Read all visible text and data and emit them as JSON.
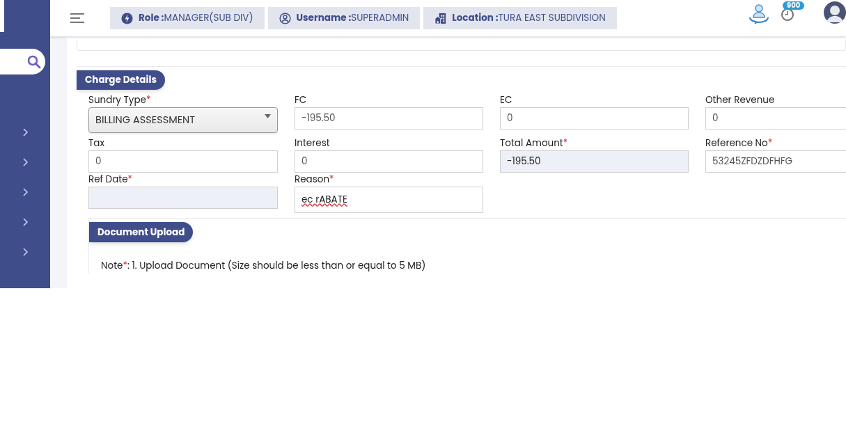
{
  "header": {
    "chips": [
      {
        "kind": "role",
        "label": "Role :",
        "value": "MANAGER(SUB DIV)"
      },
      {
        "kind": "user",
        "label": "Username :",
        "value": "SUPERADMIN"
      },
      {
        "kind": "location",
        "label": "Location :",
        "value": "TURA EAST SUBDIVISION"
      }
    ],
    "notification_count": "900"
  },
  "sidebar": {
    "items": [
      {
        "expanded": false
      },
      {
        "expanded": false
      },
      {
        "expanded": false
      },
      {
        "expanded": false
      },
      {
        "expanded": false
      }
    ]
  },
  "charge_details": {
    "title": "Charge Details",
    "fields": [
      {
        "label": "Sundry Type",
        "required_mark": "*",
        "kind": "select",
        "value": "BILLING ASSESSMENT"
      },
      {
        "label": "FC",
        "kind": "input",
        "value": "-195.50"
      },
      {
        "label": "EC",
        "kind": "input",
        "value": "0"
      },
      {
        "label": "Other Revenue",
        "kind": "input",
        "value": "0"
      },
      {
        "label": "Tax",
        "kind": "input",
        "value": "0"
      },
      {
        "label": "Interest",
        "kind": "input",
        "value": "0"
      },
      {
        "label": "Total Amount",
        "required_mark": "*",
        "kind": "readonly",
        "value": "-195.50"
      },
      {
        "label": "Reference No",
        "required_mark": "*",
        "kind": "input",
        "value": "53245ZFDZDFHFG"
      },
      {
        "label": "Ref Date",
        "required_mark": "*",
        "kind": "readonly"
      },
      {
        "label": "Reason",
        "required_mark": "*",
        "kind": "text",
        "value": "ec rABATE",
        "spellcheck_error": true
      }
    ]
  },
  "document_upload": {
    "title": "Document Upload",
    "note_label": "Note",
    "required_mark": "*",
    "note": ": 1. Upload Document (Size should be less than or equal to 5 MB)"
  }
}
